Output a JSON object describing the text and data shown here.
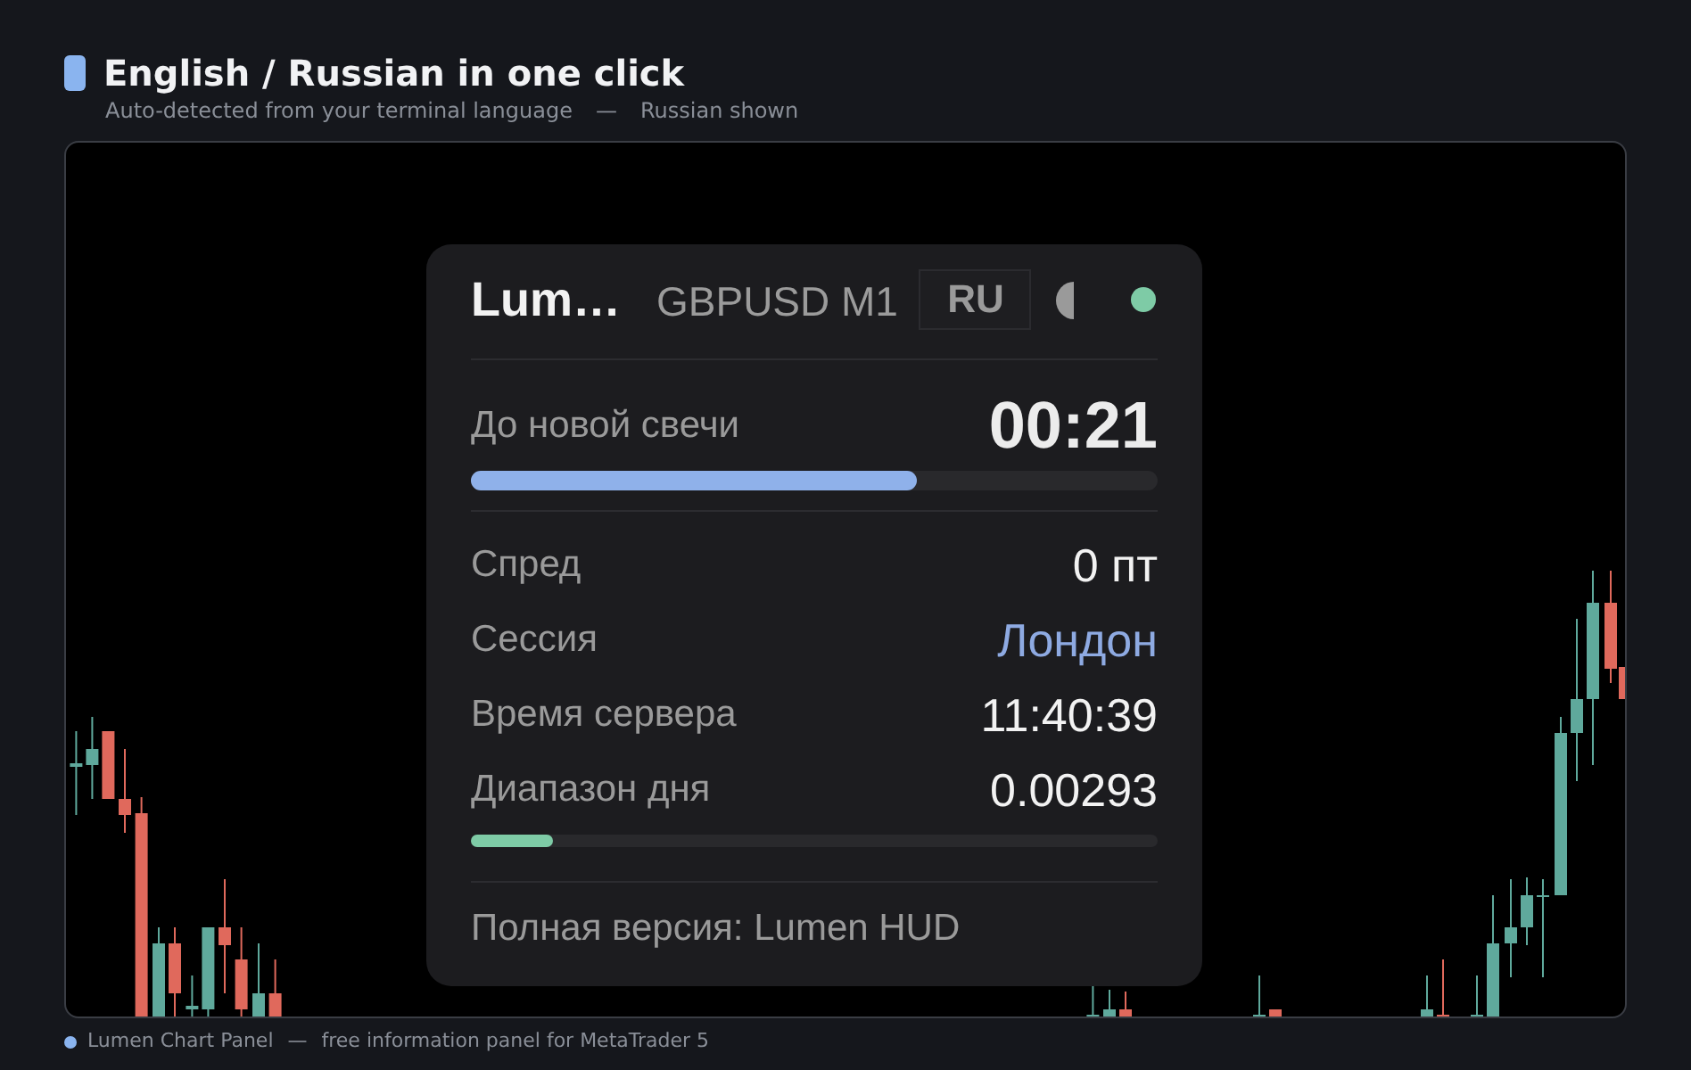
{
  "header": {
    "title": "English / Russian in one click",
    "subtitle": "Auto-detected from your terminal language",
    "separator": "—",
    "note": "Russian shown"
  },
  "panel": {
    "title": "Lum…",
    "symbol": "GBPUSD M1",
    "language": "RU",
    "connected": true,
    "countdown": {
      "label": "До новой свечи",
      "value": "00:21",
      "level": 0.65
    },
    "rows": [
      {
        "label": "Спред",
        "value": "0 пт",
        "highlight": false
      },
      {
        "label": "Сессия",
        "value": "Лондон",
        "highlight": true
      },
      {
        "label": "Время сервера",
        "value": "11:40:39",
        "highlight": false
      },
      {
        "label": "Диапазон дня",
        "value": "0.00293",
        "highlight": false
      }
    ],
    "range": {
      "level": 0.12
    },
    "footer": "Полная версия: Lumen HUD"
  },
  "footer": {
    "name": "Lumen Chart Panel",
    "separator": "—",
    "text": "free information panel for MetaTrader 5"
  }
}
